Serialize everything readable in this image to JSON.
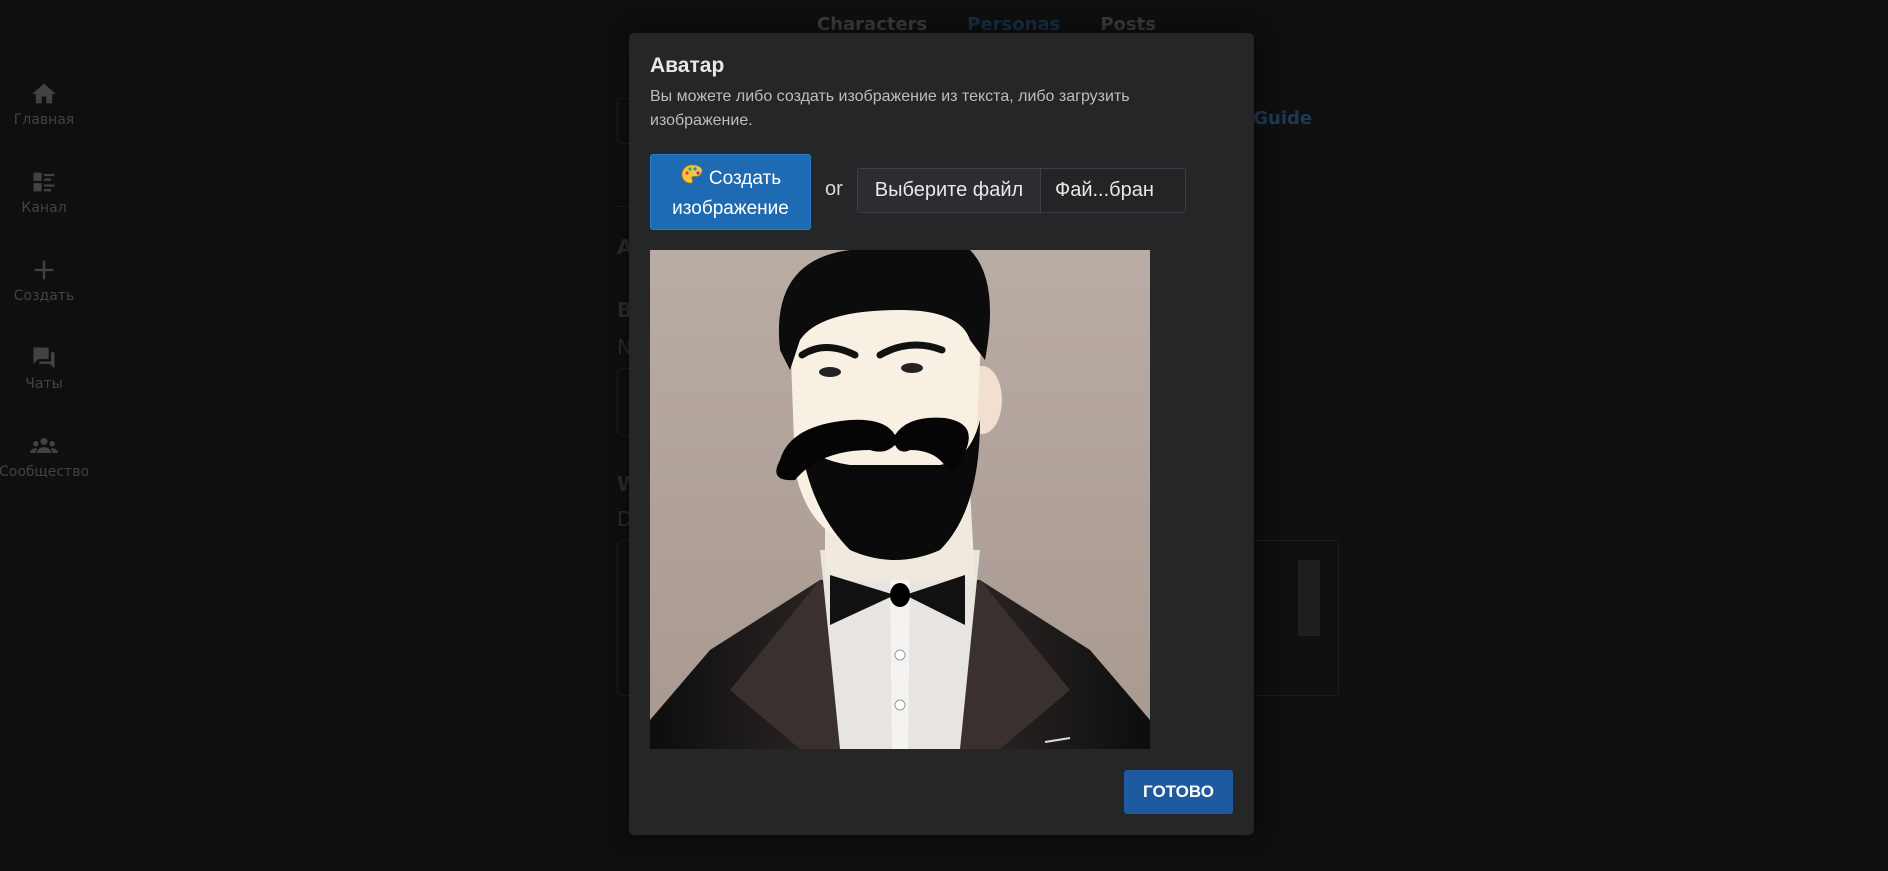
{
  "sidebar": {
    "items": [
      {
        "label": "Главная",
        "icon": "home-icon"
      },
      {
        "label": "Канал",
        "icon": "feed-icon"
      },
      {
        "label": "Создать",
        "icon": "plus-icon"
      },
      {
        "label": "Чаты",
        "icon": "chat-icon"
      },
      {
        "label": "Сообщество",
        "icon": "community-icon"
      }
    ]
  },
  "topnav": {
    "tabs": [
      {
        "label": "Characters"
      },
      {
        "label": "Personas",
        "active": true
      },
      {
        "label": "Posts"
      }
    ]
  },
  "background": {
    "guide_link": "na Guide",
    "letters": [
      "A",
      "B",
      "N",
      "W",
      "D"
    ]
  },
  "modal": {
    "title": "Аватар",
    "description": "Вы можете либо создать изображение из текста, либо загрузить изображение.",
    "create_button": "Создать изображение",
    "create_button_line1": "Создать",
    "create_button_line2": "изображение",
    "or_text": "or",
    "file_button": "Выберите файл",
    "file_name": "Фай...бран",
    "done_button": "ГОТОВО"
  },
  "colors": {
    "accent": "#1f6bb3",
    "done_button": "#1e5aa0",
    "modal_bg": "#252627",
    "page_bg": "#141414"
  }
}
